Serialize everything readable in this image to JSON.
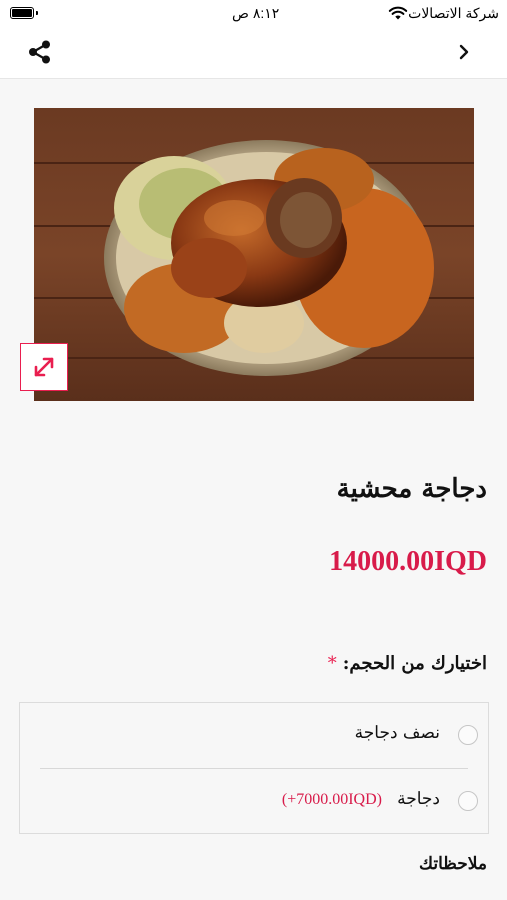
{
  "status_bar": {
    "carrier": "شركة الاتصالات",
    "time": "٨:١٢ ص"
  },
  "nav": {
    "back_icon": "chevron-right-icon",
    "share_icon": "share-icon"
  },
  "product": {
    "title": "دجاجة محشية",
    "price": "14000.00IQD",
    "expand_icon": "expand-icon"
  },
  "size_option": {
    "label": "اختيارك من الحجم:",
    "required_mark": "*",
    "choices": [
      {
        "label": "نصف دجاجة",
        "extra_price": ""
      },
      {
        "label": "دجاجة",
        "extra_price": "(+7000.00IQD)"
      }
    ]
  },
  "notes": {
    "label": "ملاحظاتك"
  },
  "colors": {
    "accent": "#d81b4a",
    "background": "#f7f7f7"
  }
}
